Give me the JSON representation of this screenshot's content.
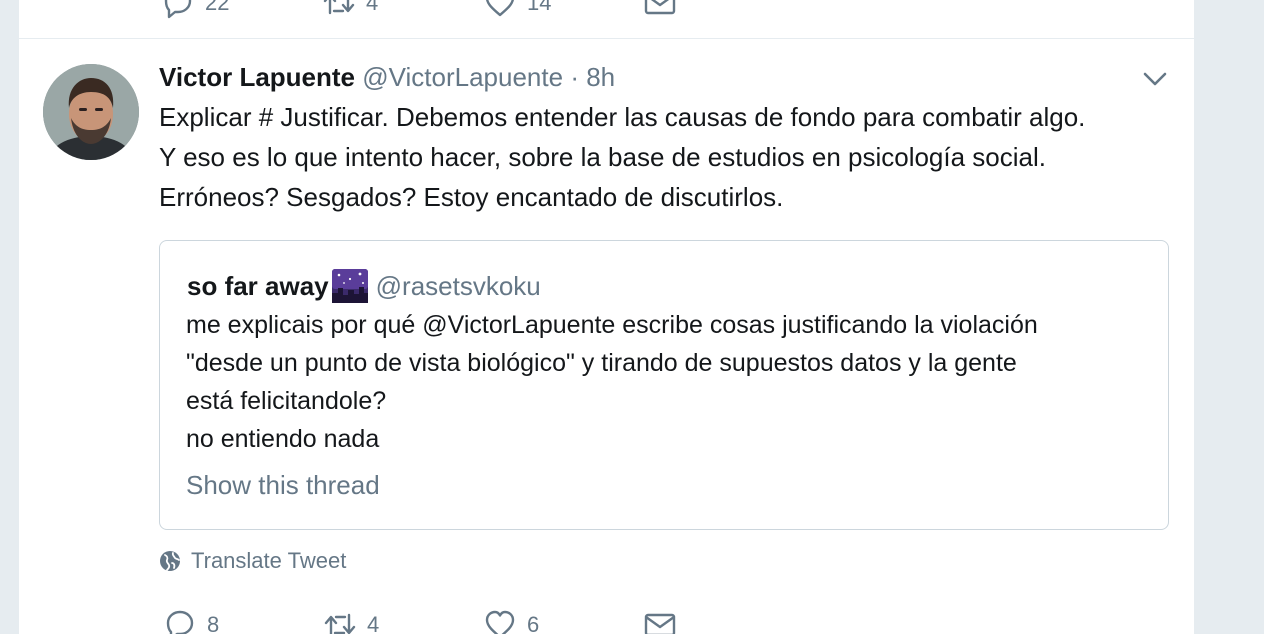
{
  "previous_tweet": {
    "reply_count": "22",
    "retweet_count": "4",
    "like_count": "14"
  },
  "tweet": {
    "fullname": "Victor Lapuente",
    "username": "@VictorLapuente",
    "time": "· 8h",
    "text_lines": [
      "Explicar # Justificar. Debemos entender las causas de fondo para combatir algo.",
      "Y eso es lo que intento hacer, sobre la base de estudios en psicología social.",
      "Erróneos? Sesgados? Estoy encantado de discutirlos."
    ],
    "quoted": {
      "fullname": "so far away",
      "emoji": "night-with-stars",
      "username": "@rasetsvkoku",
      "text_lines": [
        "me explicais por qué @VictorLapuente escribe cosas justificando la violación",
        "\"desde un punto de vista biológico\" y tirando de supuestos datos y la gente",
        "está felicitandole?",
        "no entiendo nada"
      ],
      "show_thread": "Show this thread"
    },
    "translate_label": "Translate Tweet",
    "reply_count": "8",
    "retweet_count": "4",
    "like_count": "6"
  },
  "icons": {
    "reply": "reply-icon",
    "retweet": "retweet-icon",
    "like": "heart-icon",
    "dm": "envelope-icon",
    "caret": "chevron-down-icon",
    "translate": "globe-icon"
  },
  "colors": {
    "background": "#e6ecf0",
    "card": "#ffffff",
    "text": "#14171a",
    "secondary_text": "#657786",
    "border": "#ccd6dd"
  }
}
